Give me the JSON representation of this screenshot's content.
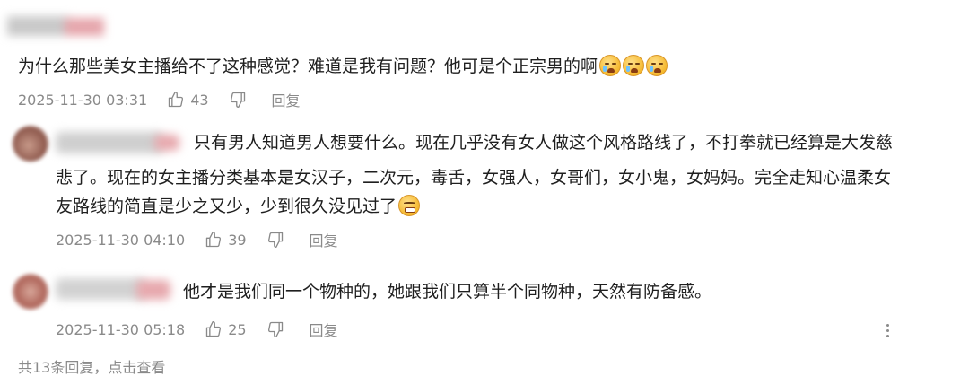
{
  "main_comment": {
    "text": "为什么那些美女主播给不了这种感觉？难道是我有问题？他可是个正宗男的啊",
    "emojis": [
      "crying-laughing-emoji",
      "crying-laughing-emoji",
      "crying-laughing-emoji"
    ],
    "time": "2025-11-30 03:31",
    "likes": "43",
    "reply_label": "回复"
  },
  "replies": [
    {
      "lines": [
        "只有男人知道男人想要什么。现在几乎没有女人做这个风格路线了，不打拳就已经算是大发慈",
        "悲了。现在的女主播分类基本是女汉子，二次元，毒舌，女强人，女哥们，女小鬼，女妈妈。完全走知心温柔女",
        "友路线的简直是少之又少，少到很久没见过了"
      ],
      "emoji": "grimacing-emoji",
      "time": "2025-11-30 04:10",
      "likes": "39",
      "reply_label": "回复"
    },
    {
      "lines": [
        "他才是我们同一个物种的，她跟我们只算半个同物种，天然有防备感。"
      ],
      "time": "2025-11-30 05:18",
      "likes": "25",
      "reply_label": "回复"
    }
  ],
  "footer": {
    "view_all": "共13条回复，点击查看"
  },
  "colors": {
    "text": "#1f1f1f",
    "meta": "#8a8a8a",
    "background": "#ffffff"
  }
}
